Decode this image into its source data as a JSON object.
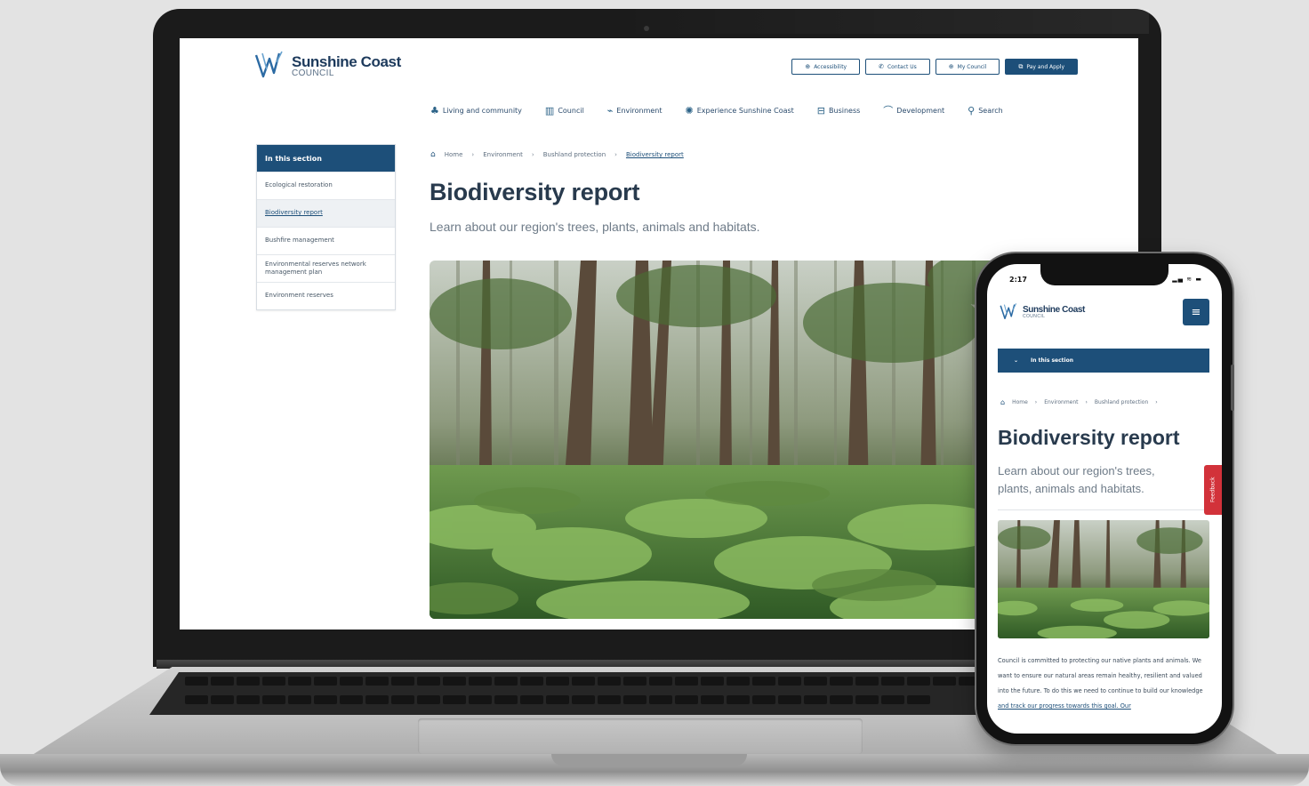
{
  "site": {
    "logo_name": "Sunshine Coast",
    "logo_sub": "COUNCIL"
  },
  "utility_nav": [
    {
      "label": "Accessibility",
      "icon": "accessibility-icon",
      "glyph": "⊕"
    },
    {
      "label": "Contact Us",
      "icon": "phone-icon",
      "glyph": "✆"
    },
    {
      "label": "My Council",
      "icon": "user-icon",
      "glyph": "⊕"
    },
    {
      "label": "Pay and Apply",
      "icon": "pay-icon",
      "glyph": "⧉"
    }
  ],
  "main_nav": [
    {
      "label": "Living and community",
      "icon": "community-icon",
      "glyph": "♣"
    },
    {
      "label": "Council",
      "icon": "building-icon",
      "glyph": "▥"
    },
    {
      "label": "Environment",
      "icon": "leaf-icon",
      "glyph": "⌁"
    },
    {
      "label": "Experience Sunshine Coast",
      "icon": "sun-icon",
      "glyph": "✺"
    },
    {
      "label": "Business",
      "icon": "briefcase-icon",
      "glyph": "⊟"
    },
    {
      "label": "Development",
      "icon": "hardhat-icon",
      "glyph": "⌒"
    },
    {
      "label": "Search",
      "icon": "search-icon",
      "glyph": "⚲"
    }
  ],
  "sidenav": {
    "heading": "In this section",
    "items": [
      {
        "label": "Ecological restoration",
        "active": false
      },
      {
        "label": "Biodiversity report",
        "active": true
      },
      {
        "label": "Bushfire management",
        "active": false
      },
      {
        "label": "Environmental reserves network management plan",
        "active": false
      },
      {
        "label": "Environment reserves",
        "active": false
      }
    ]
  },
  "breadcrumbs": [
    "Home",
    "Environment",
    "Bushland protection",
    "Biodiversity report"
  ],
  "page": {
    "title": "Biodiversity report",
    "lead": "Learn about our region's trees, plants, animals and habitats."
  },
  "phone": {
    "time": "2:17",
    "status_icons": "▂▄ ≋ ▬",
    "menu_glyph": "≡",
    "section_label": "In this section",
    "breadcrumbs": [
      "Home",
      "Environment",
      "Bushland protection"
    ],
    "title": "Biodiversity report",
    "lead": "Learn about our region's trees, plants, animals and habitats.",
    "feedback": "Feedback",
    "body": "Council is committed to protecting our native plants and animals. We want to ensure our natural areas remain healthy, resilient and valued into the future. To do this we need to continue to build our knowledge",
    "body_link": "and track our progress towards this goal. Our"
  },
  "colors": {
    "brand_blue": "#1d4f79",
    "title": "#283a4d",
    "feedback": "#d2323a"
  }
}
